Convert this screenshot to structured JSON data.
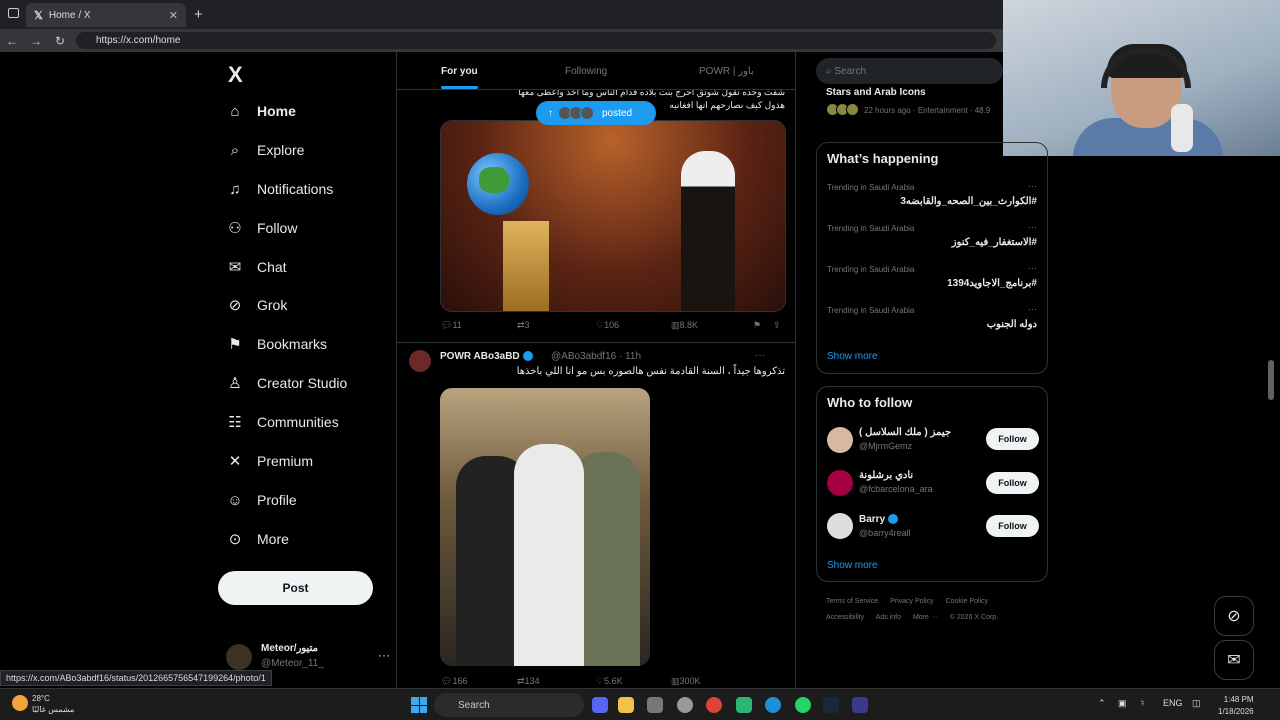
{
  "browser": {
    "tab_title": "Home / X",
    "tab_close": "✕",
    "new_tab": "+",
    "url": "https://x.com/home",
    "status_url": "https://x.com/ABo3abdf16/status/2012665756547199264/photo/1"
  },
  "sidebar": {
    "logo": "X",
    "items": [
      {
        "label": "Home",
        "icon": "home-icon"
      },
      {
        "label": "Explore",
        "icon": "search-icon"
      },
      {
        "label": "Notifications",
        "icon": "bell-icon"
      },
      {
        "label": "Follow",
        "icon": "follow-icon"
      },
      {
        "label": "Chat",
        "icon": "mail-icon"
      },
      {
        "label": "Grok",
        "icon": "grok-icon"
      },
      {
        "label": "Bookmarks",
        "icon": "bookmark-icon"
      },
      {
        "label": "Creator Studio",
        "icon": "creator-icon"
      },
      {
        "label": "Communities",
        "icon": "communities-icon"
      },
      {
        "label": "Premium",
        "icon": "x-icon"
      },
      {
        "label": "Profile",
        "icon": "profile-icon"
      },
      {
        "label": "More",
        "icon": "more-icon"
      }
    ],
    "post_label": "Post",
    "account": {
      "name": "Meteor/متيور",
      "handle": "@Meteor_11_",
      "more": "···"
    }
  },
  "feed": {
    "tabs": [
      "For you",
      "Following",
      "POWR | باور"
    ],
    "posted_label": "posted",
    "tweet1": {
      "text": "شفت وحده تقول شوتق احرج بنت بلاده قدام الناس وما اخذ واعطى معها هذول كيف نصارحهم انها افغانيه",
      "replies": "11",
      "retweets": "3",
      "likes": "106",
      "views": "8.8K"
    },
    "tweet2": {
      "name": "POWR ABo3aBD",
      "handle": "@ABo3abdf16 · 11h",
      "text": "تذكروها جيداً ، السنة القادمة نفس هالصوره بس مو انا اللي باخذها",
      "more": "···",
      "replies": "166",
      "retweets": "134",
      "likes": "5.6K",
      "views": "300K"
    }
  },
  "right": {
    "search_placeholder": "Search",
    "stars_title": "Stars and Arab Icons",
    "stars_meta": "22 hours ago · Entertainment · 48.9",
    "happening_title": "What’s happening",
    "trends": [
      {
        "category": "Trending in Saudi Arabia",
        "title": "#الكوارث_بين_الصحه_والقابضه3"
      },
      {
        "category": "Trending in Saudi Arabia",
        "title": "#الاستغفار_فيه_كنوز"
      },
      {
        "category": "Trending in Saudi Arabia",
        "title": "#برنامج_الاجاويد1394"
      },
      {
        "category": "Trending in Saudi Arabia",
        "title": "دوله الجنوب"
      }
    ],
    "trend_more": "···",
    "show_more": "Show more",
    "wtf_title": "Who to follow",
    "follow_label": "Follow",
    "suggestions": [
      {
        "name": "جيمز ( ملك السلاسل )",
        "handle": "@MjrmGemz"
      },
      {
        "name": "نادي برشلونة",
        "handle": "@fcbarcelona_ara"
      },
      {
        "name": "Barry",
        "handle": "@barry4reall"
      }
    ],
    "footer": [
      "Terms of Service",
      "Privacy Policy",
      "Cookie Policy",
      "Accessibility",
      "Ads info",
      "More ···",
      "© 2026 X Corp."
    ]
  },
  "taskbar": {
    "temp": "28°C",
    "weather": "مشمس غالبًا",
    "search": "Search",
    "lang": "ENG",
    "time": "1:48 PM",
    "date": "1/18/2026"
  }
}
